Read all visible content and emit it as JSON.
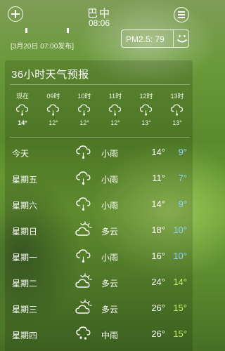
{
  "header": {
    "city": "巴中",
    "time": "08:06",
    "release": "[3月20日 07:00发布]",
    "pm_label": "PM2.5: 79"
  },
  "icons": {
    "add": "add-icon",
    "menu": "menu-icon",
    "pm_face": "smiley-face-icon",
    "light_rain": "light-rain-icon",
    "cloudy": "partly-cloudy-icon",
    "moderate_rain": "moderate-rain-icon"
  },
  "colors": {
    "cool_low": "#8fd0ff",
    "warm_low": "#c9ee6a"
  },
  "forecast": {
    "title": "36小时天气预报",
    "hours": [
      {
        "label": "现在",
        "temp": "14°",
        "icon": "light_rain",
        "current": true
      },
      {
        "label": "09时",
        "temp": "12°",
        "icon": "light_rain"
      },
      {
        "label": "10时",
        "temp": "12°",
        "icon": "light_rain"
      },
      {
        "label": "11时",
        "temp": "12°",
        "icon": "light_rain"
      },
      {
        "label": "12时",
        "temp": "13°",
        "icon": "light_rain"
      },
      {
        "label": "13时",
        "temp": "13°",
        "icon": "light_rain"
      }
    ]
  },
  "days": [
    {
      "name": "今天",
      "condition": "小雨",
      "high": "14°",
      "low": "9°",
      "icon": "light_rain",
      "low_color": "cool"
    },
    {
      "name": "星期五",
      "condition": "小雨",
      "high": "11°",
      "low": "7°",
      "icon": "light_rain",
      "low_color": "cool"
    },
    {
      "name": "星期六",
      "condition": "小雨",
      "high": "14°",
      "low": "9°",
      "icon": "light_rain",
      "low_color": "cool"
    },
    {
      "name": "星期日",
      "condition": "多云",
      "high": "18°",
      "low": "10°",
      "icon": "cloudy",
      "low_color": "cool"
    },
    {
      "name": "星期一",
      "condition": "小雨",
      "high": "16°",
      "low": "10°",
      "icon": "light_rain",
      "low_color": "cool"
    },
    {
      "name": "星期二",
      "condition": "多云",
      "high": "24°",
      "low": "14°",
      "icon": "cloudy",
      "low_color": "warm"
    },
    {
      "name": "星期三",
      "condition": "多云",
      "high": "26°",
      "low": "15°",
      "icon": "cloudy",
      "low_color": "warm"
    },
    {
      "name": "星期四",
      "condition": "中雨",
      "high": "26°",
      "low": "15°",
      "icon": "moderate_rain",
      "low_color": "warm"
    }
  ]
}
